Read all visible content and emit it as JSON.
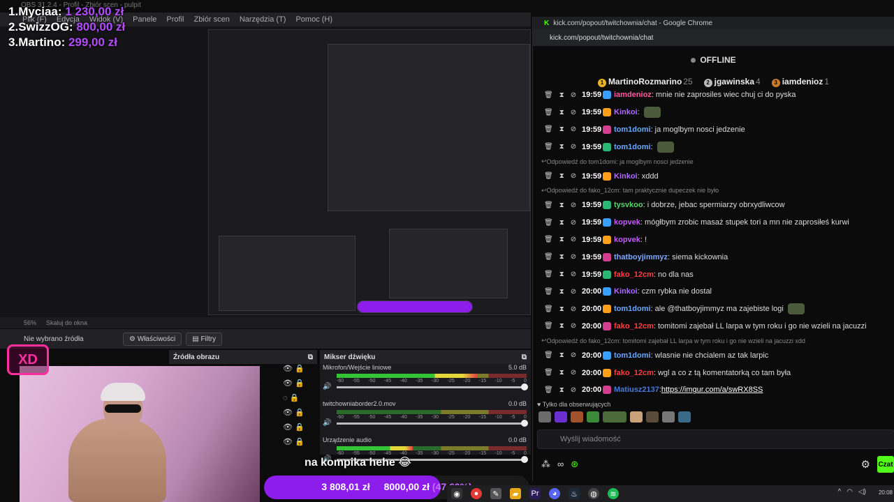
{
  "leaderboard": [
    {
      "rank": "1.",
      "name": "Myciaa:",
      "amount": "1 230,00 zł"
    },
    {
      "rank": "2.",
      "name": "SwizzOG:",
      "amount": "800,00 zł"
    },
    {
      "rank": "3.",
      "name": "Martino:",
      "amount": "299,00 zł"
    }
  ],
  "obs": {
    "title": "OBS 31.2.4 - Profil - Zbiór scen - pulpit",
    "menu": [
      "Plik (F)",
      "Edycja",
      "Widok (V)",
      "Panele",
      "Profil",
      "Zbiór scen",
      "Narzędzia (T)",
      "Pomoc (H)"
    ],
    "zoom": "56%",
    "scale_label": "Skaluj do okna",
    "no_source": "Nie wybrano źródła",
    "properties": "Właściwości",
    "filters": "Filtry",
    "sources_title": "Źródła obrazu",
    "mixer_title": "Mikser dźwięku",
    "mixer": [
      {
        "name": "Mikrofon/Wejście liniowe",
        "db": "5.0 dB",
        "level": 0.74
      },
      {
        "name": "twitchowniaborder2.0.mov",
        "db": "0.0 dB",
        "level": 0.0
      },
      {
        "name": "Urządzenie audio",
        "db": "0.0 dB",
        "level": 0.4
      }
    ],
    "ticks": [
      "-60",
      "-55",
      "-50",
      "-45",
      "-40",
      "-35",
      "-30",
      "-25",
      "-20",
      "-15",
      "-10",
      "-5",
      "0"
    ],
    "xd_badge": "XD"
  },
  "overlay": {
    "caption": "na kompika hehe 😂",
    "raised": "3 808,01 zł",
    "goal": "8000,00 zł",
    "percent": "(47.60%)",
    "percent_value": 0.476
  },
  "chrome": {
    "title": "kick.com/popout/twitchownia/chat - Google Chrome",
    "url": "kick.com/popout/twitchownia/chat",
    "status": "OFFLINE",
    "gifters": [
      {
        "name": "MartinoRozmarino",
        "count": "25",
        "medal": "1"
      },
      {
        "name": "jgawinska",
        "count": "4",
        "medal": "2"
      },
      {
        "name": "iamdenioz",
        "count": "1",
        "medal": "3"
      }
    ],
    "items": [
      {
        "type": "msg",
        "time": "19:59",
        "user": "iamdenioz",
        "color": "#ff5a9e",
        "text": ": mnie nie zaprosiles wiec chuj ci do pyska"
      },
      {
        "type": "msg",
        "time": "19:59",
        "user": "Kinkoi",
        "color": "#b06bff",
        "text": ":",
        "emote": true
      },
      {
        "type": "msg",
        "time": "19:59",
        "user": "tom1domi",
        "color": "#6aa7ff",
        "text": ": ja moglbym nosci jedzenie"
      },
      {
        "type": "msg",
        "time": "19:59",
        "user": "tom1domi",
        "color": "#6aa7ff",
        "text": ":",
        "emote": true
      },
      {
        "type": "reply",
        "text": "Odpowiedź do tom1domi: ja moglbym nosci jedzenie"
      },
      {
        "type": "msg",
        "time": "19:59",
        "user": "Kinkoi",
        "color": "#b06bff",
        "text": ": xddd"
      },
      {
        "type": "reply",
        "text": "Odpowiedź do fako_12cm: tam praktycznie dupeczek nie było"
      },
      {
        "type": "msg",
        "time": "19:59",
        "user": "tysvkoo",
        "color": "#5ad66a",
        "text": ": i dobrze, jebac spermiarzy obrxydliwcow"
      },
      {
        "type": "msg",
        "time": "19:59",
        "user": "kopvek",
        "color": "#c45cff",
        "text": ": mógłbym zrobic masaż stupek tori a mn nie zaprosiłeś kurwi"
      },
      {
        "type": "msg",
        "time": "19:59",
        "user": "kopvek",
        "color": "#c45cff",
        "text": ": !"
      },
      {
        "type": "msg",
        "time": "19:59",
        "user": "thatboyjimmyz",
        "color": "#7fa8ff",
        "text": ": siema kickownia"
      },
      {
        "type": "msg",
        "time": "19:59",
        "user": "fako_12cm",
        "color": "#ff4040",
        "text": ": no dla nas"
      },
      {
        "type": "msg",
        "time": "20:00",
        "user": "Kinkoi",
        "color": "#b06bff",
        "text": ": czm rybka nie dostal"
      },
      {
        "type": "msg",
        "time": "20:00",
        "user": "tom1domi",
        "color": "#6aa7ff",
        "text": ": ale @thatboyjimmyz ma zajebiste logi",
        "emote": true
      },
      {
        "type": "msg",
        "time": "20:00",
        "user": "fako_12cm",
        "color": "#ff4040",
        "text": ": tomitomi zajebał  LL  larpa w tym roku i go nie wzieli na jacuzzi"
      },
      {
        "type": "reply",
        "text": "Odpowiedź do fako_12cm: tomitomi zajebał LL larpa w tym roku i go nie wzieli na jacuzzi xdd"
      },
      {
        "type": "msg",
        "time": "20:00",
        "user": "tom1domi",
        "color": "#6aa7ff",
        "text": ": wlasnie nie chcialem az tak larpic"
      },
      {
        "type": "msg",
        "time": "20:00",
        "user": "fako_12cm",
        "color": "#ff4040",
        "text": ": wgl a co z tą komentatorką co tam była"
      },
      {
        "type": "msg",
        "time": "20:00",
        "user": "Matiusz2137",
        "color": "#4a7ad6",
        "text": ": ",
        "link": "https://imgur.com/a/swRX8SS"
      }
    ],
    "followers_only": "Tylko dla obserwujących",
    "input_placeholder": "Wyślij wiadomość",
    "chat_button": "Czat"
  },
  "taskbar": {
    "clock": "20:08"
  }
}
